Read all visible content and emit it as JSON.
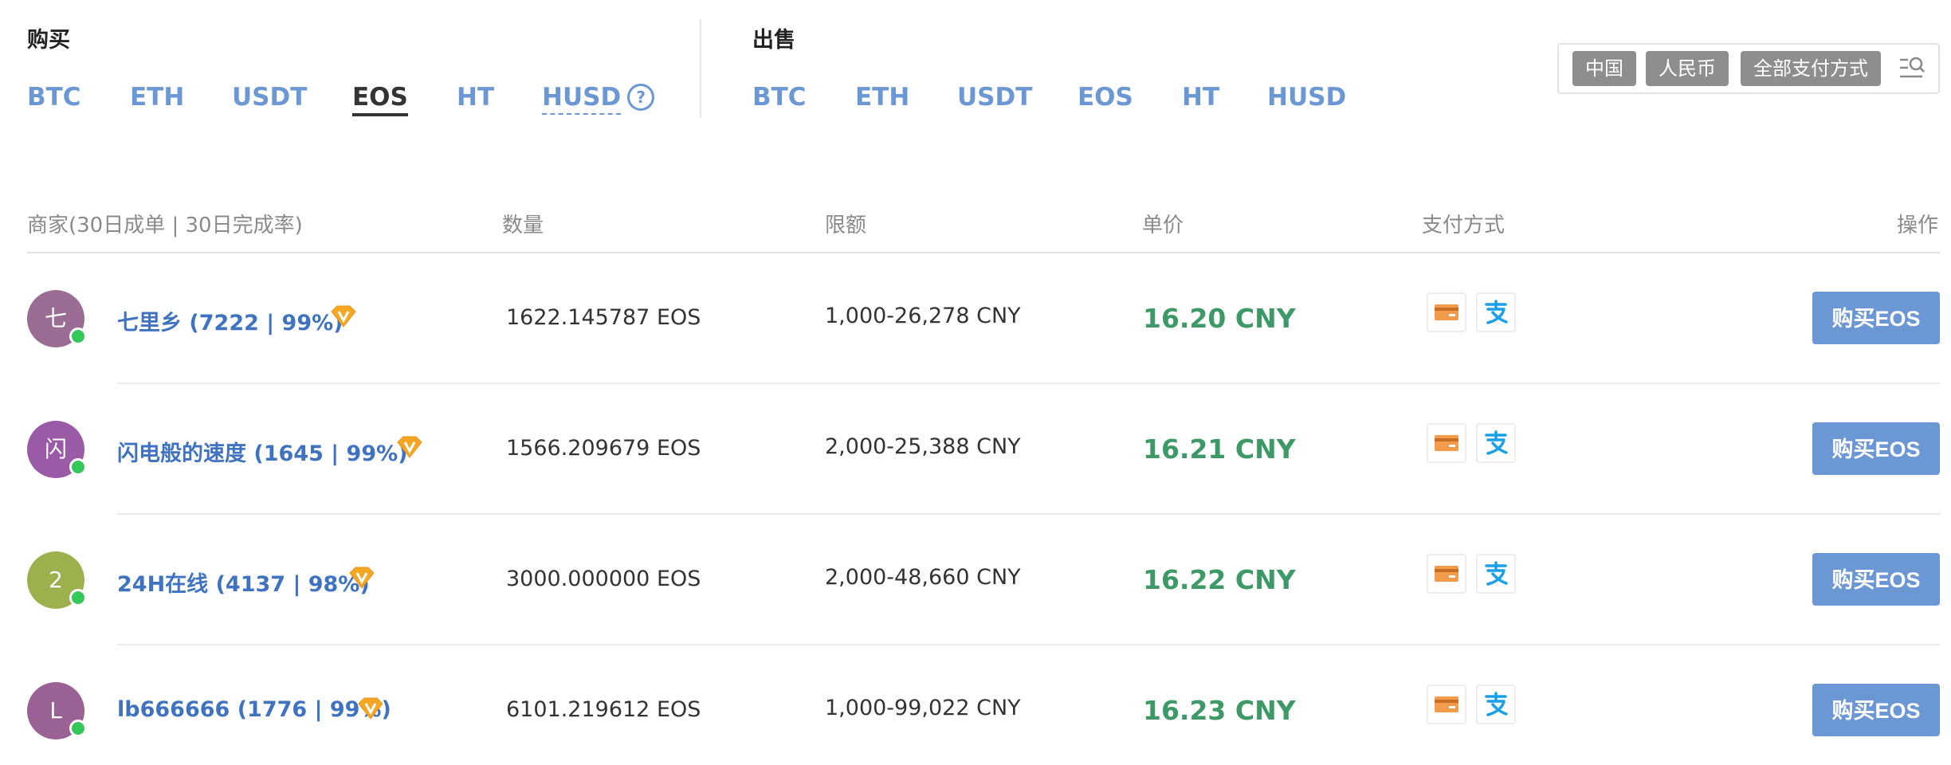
{
  "buy_section": {
    "title": "购买",
    "coins": [
      "BTC",
      "ETH",
      "USDT",
      "EOS",
      "HT",
      "HUSD"
    ],
    "active": "EOS",
    "help_glyph": "?"
  },
  "sell_section": {
    "title": "出售",
    "coins": [
      "BTC",
      "ETH",
      "USDT",
      "EOS",
      "HT",
      "HUSD"
    ]
  },
  "filters": {
    "country": "中国",
    "currency": "人民币",
    "payment": "全部支付方式"
  },
  "table": {
    "headers": {
      "merchant": "商家(30日成单 | 30日完成率)",
      "quantity": "数量",
      "limit": "限额",
      "price": "单价",
      "payment": "支付方式",
      "action": "操作"
    },
    "rows": [
      {
        "avatar": "七",
        "avatar_color": "#9b6c94",
        "merchant": "七里乡 (7222 | 99%)",
        "quantity": "1622.145787 EOS",
        "limit": "1,000-26,278 CNY",
        "price": "16.20 CNY",
        "button": "购买EOS"
      },
      {
        "avatar": "闪",
        "avatar_color": "#9a5aa6",
        "merchant": "闪电般的速度 (1645 | 99%)",
        "quantity": "1566.209679 EOS",
        "limit": "2,000-25,388 CNY",
        "price": "16.21 CNY",
        "button": "购买EOS"
      },
      {
        "avatar": "2",
        "avatar_color": "#9db04e",
        "merchant": "24H在线 (4137 | 98%)",
        "quantity": "3000.000000 EOS",
        "limit": "2,000-48,660 CNY",
        "price": "16.22 CNY",
        "button": "购买EOS"
      },
      {
        "avatar": "L",
        "avatar_color": "#9a6194",
        "merchant": "lb666666 (1776 | 99%)",
        "quantity": "6101.219612 EOS",
        "limit": "1,000-99,022 CNY",
        "price": "16.23 CNY",
        "button": "购买EOS"
      }
    ]
  },
  "colors": {
    "link": "#6b97d4",
    "merchant": "#3f73c1",
    "price": "#3d9a66",
    "button": "#6b97d4",
    "online": "#34c759",
    "badge": "#f5a623"
  },
  "icons": [
    "help-icon",
    "filter-search-icon",
    "diamond-v-badge-icon",
    "bank-card-icon",
    "alipay-icon"
  ]
}
